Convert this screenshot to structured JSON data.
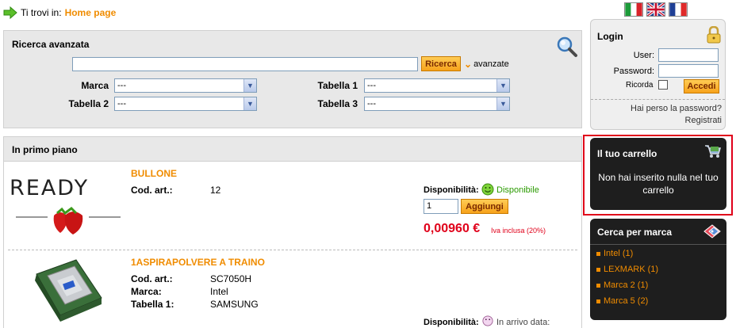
{
  "breadcrumb": {
    "prefix": "Ti trovi in:",
    "home": "Home page"
  },
  "languages": [
    "it-flag",
    "uk-flag",
    "fr-flag"
  ],
  "search": {
    "title": "Ricerca avanzata",
    "query": "",
    "search_button": "Ricerca",
    "advanced_link": "avanzate",
    "filters": [
      {
        "label": "Marca",
        "value": "---"
      },
      {
        "label": "Tabella 1",
        "value": "---"
      },
      {
        "label": "Tabella 2",
        "value": "---"
      },
      {
        "label": "Tabella 3",
        "value": "---"
      }
    ]
  },
  "featured": {
    "title": "In primo piano",
    "products": [
      {
        "logo_text": "READY",
        "name": "BULLONE",
        "fields": [
          {
            "label": "Cod. art.:",
            "value": "12"
          }
        ],
        "availability_label": "Disponibilità:",
        "availability": "Disponibile",
        "quantity": "1",
        "add_button": "Aggiungi",
        "price": "0,00960 €",
        "vat_note": "Iva inclusa (20%)"
      },
      {
        "name": "1ASPIRAPOLVERE A TRAINO",
        "fields": [
          {
            "label": "Cod. art.:",
            "value": "SC7050H"
          },
          {
            "label": "Marca:",
            "value": "Intel"
          },
          {
            "label": "Tabella 1:",
            "value": "SAMSUNG"
          }
        ],
        "availability_label": "Disponibilità:",
        "availability": "In arrivo data:"
      }
    ]
  },
  "login": {
    "title": "Login",
    "user_label": "User:",
    "user_value": "",
    "password_label": "Password:",
    "password_value": "",
    "remember_label": "Ricorda",
    "submit": "Accedi",
    "forgot_link": "Hai perso la password?",
    "register_link": "Registrati"
  },
  "cart": {
    "title": "Il tuo carrello",
    "message": "Non hai inserito nulla nel tuo carrello"
  },
  "brands": {
    "title": "Cerca per marca",
    "items": [
      "Intel (1)",
      "LEXMARK (1)",
      "Marca 2 (1)",
      "Marca 5 (2)"
    ]
  },
  "colors": {
    "accent": "#f08c00",
    "price": "#e0001a",
    "dark_box": "#1e1e1e",
    "highlight": "#e0001a"
  }
}
